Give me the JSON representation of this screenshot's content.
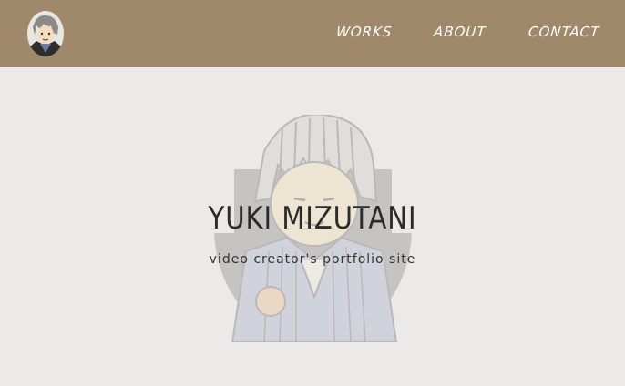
{
  "header": {
    "nav": [
      {
        "label": "WORKS"
      },
      {
        "label": "ABOUT"
      },
      {
        "label": "CONTACT"
      }
    ]
  },
  "hero": {
    "title": "YUKI MIZUTANI",
    "subtitle": "video creator's portfolio site"
  },
  "colors": {
    "header_bg": "#a0886a",
    "page_bg": "#ebeae8",
    "nav_text": "#ffffff",
    "title_text": "#2b2b2b"
  }
}
